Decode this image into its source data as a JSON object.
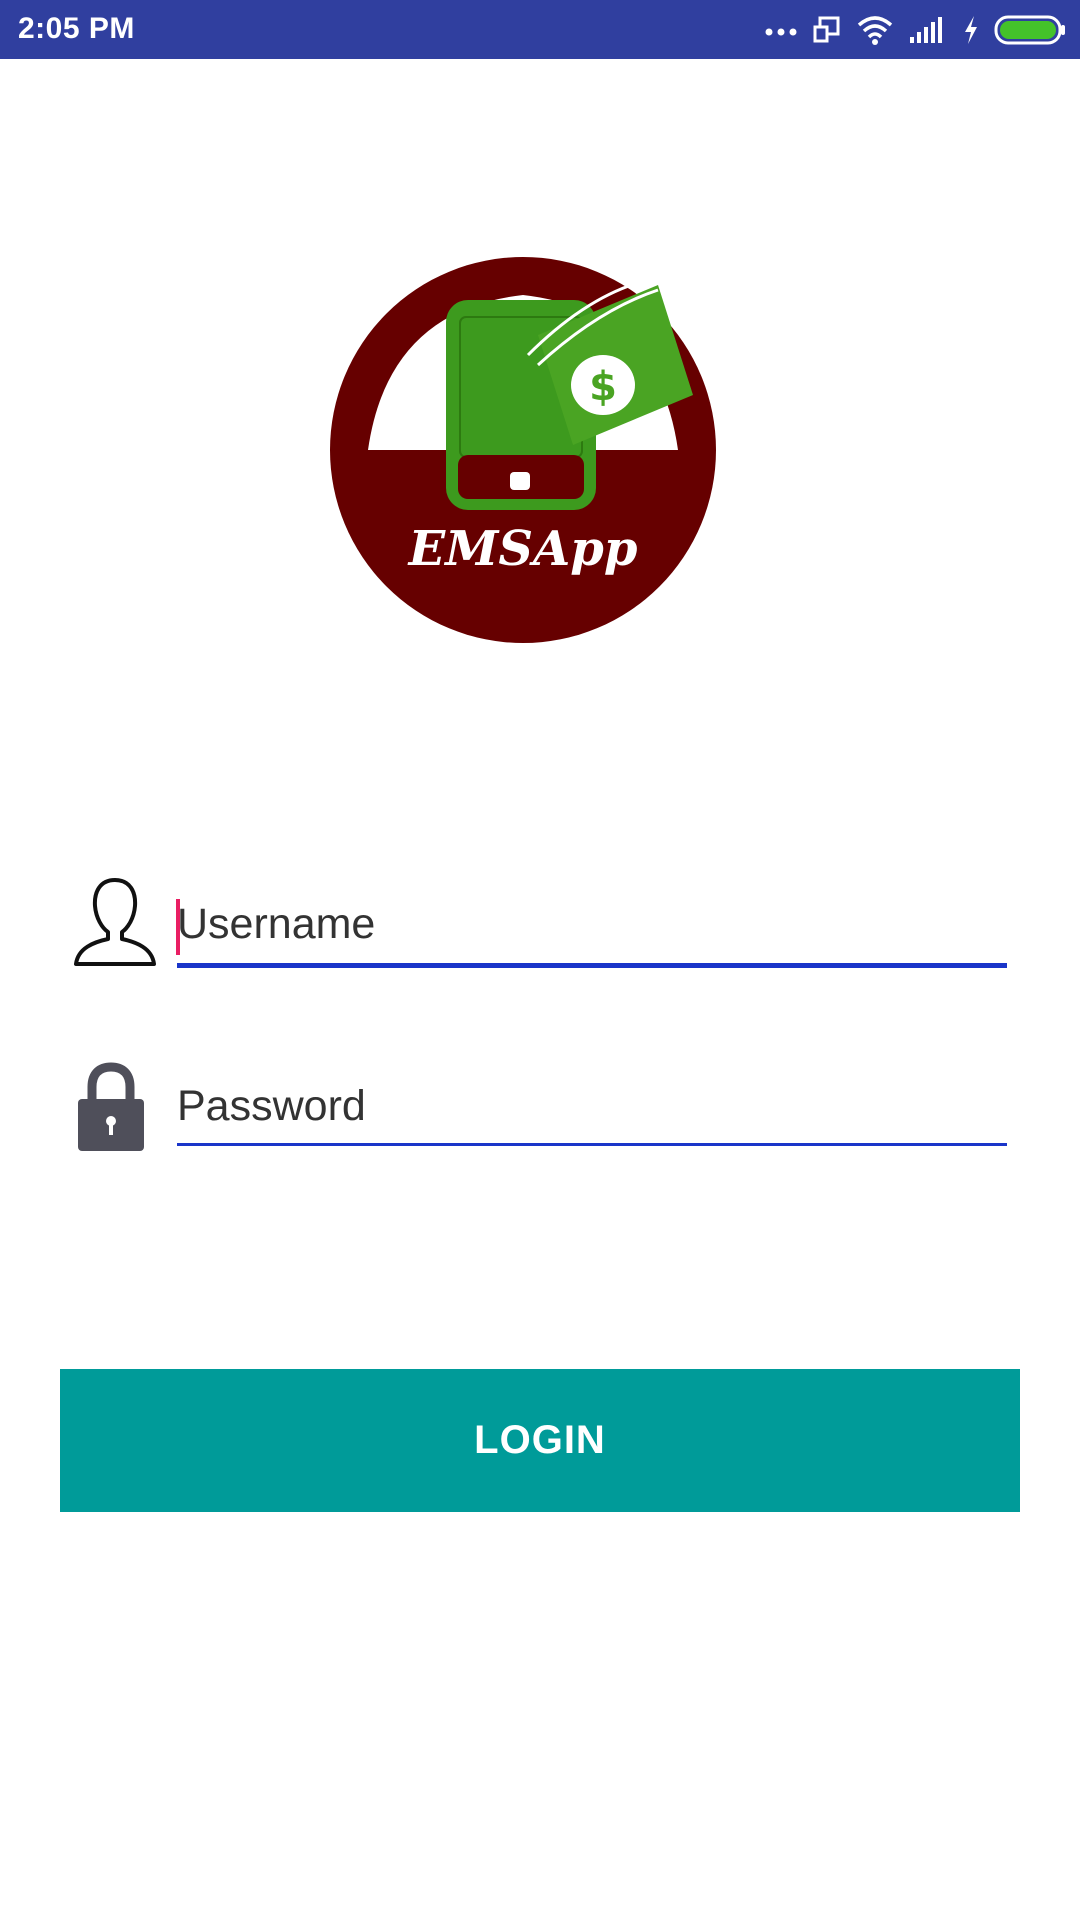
{
  "status_bar": {
    "time": "2:05 PM",
    "icons": [
      "more-dots-icon",
      "screen-rotate-icon",
      "wifi-icon",
      "signal-icon",
      "charging-bolt-icon",
      "battery-icon"
    ],
    "battery_color": "#44c22a"
  },
  "logo": {
    "text": "EMSApp",
    "circle_color": "#660000",
    "phone_color": "#3d9a1e"
  },
  "form": {
    "username": {
      "placeholder": "Username",
      "icon": "user-silhouette-icon"
    },
    "password": {
      "placeholder": "Password",
      "icon": "lock-icon"
    },
    "underline_color": "#1a35c9",
    "cursor_color": "#e91e63"
  },
  "login_button": {
    "label": "LOGIN",
    "color": "#009B99"
  }
}
